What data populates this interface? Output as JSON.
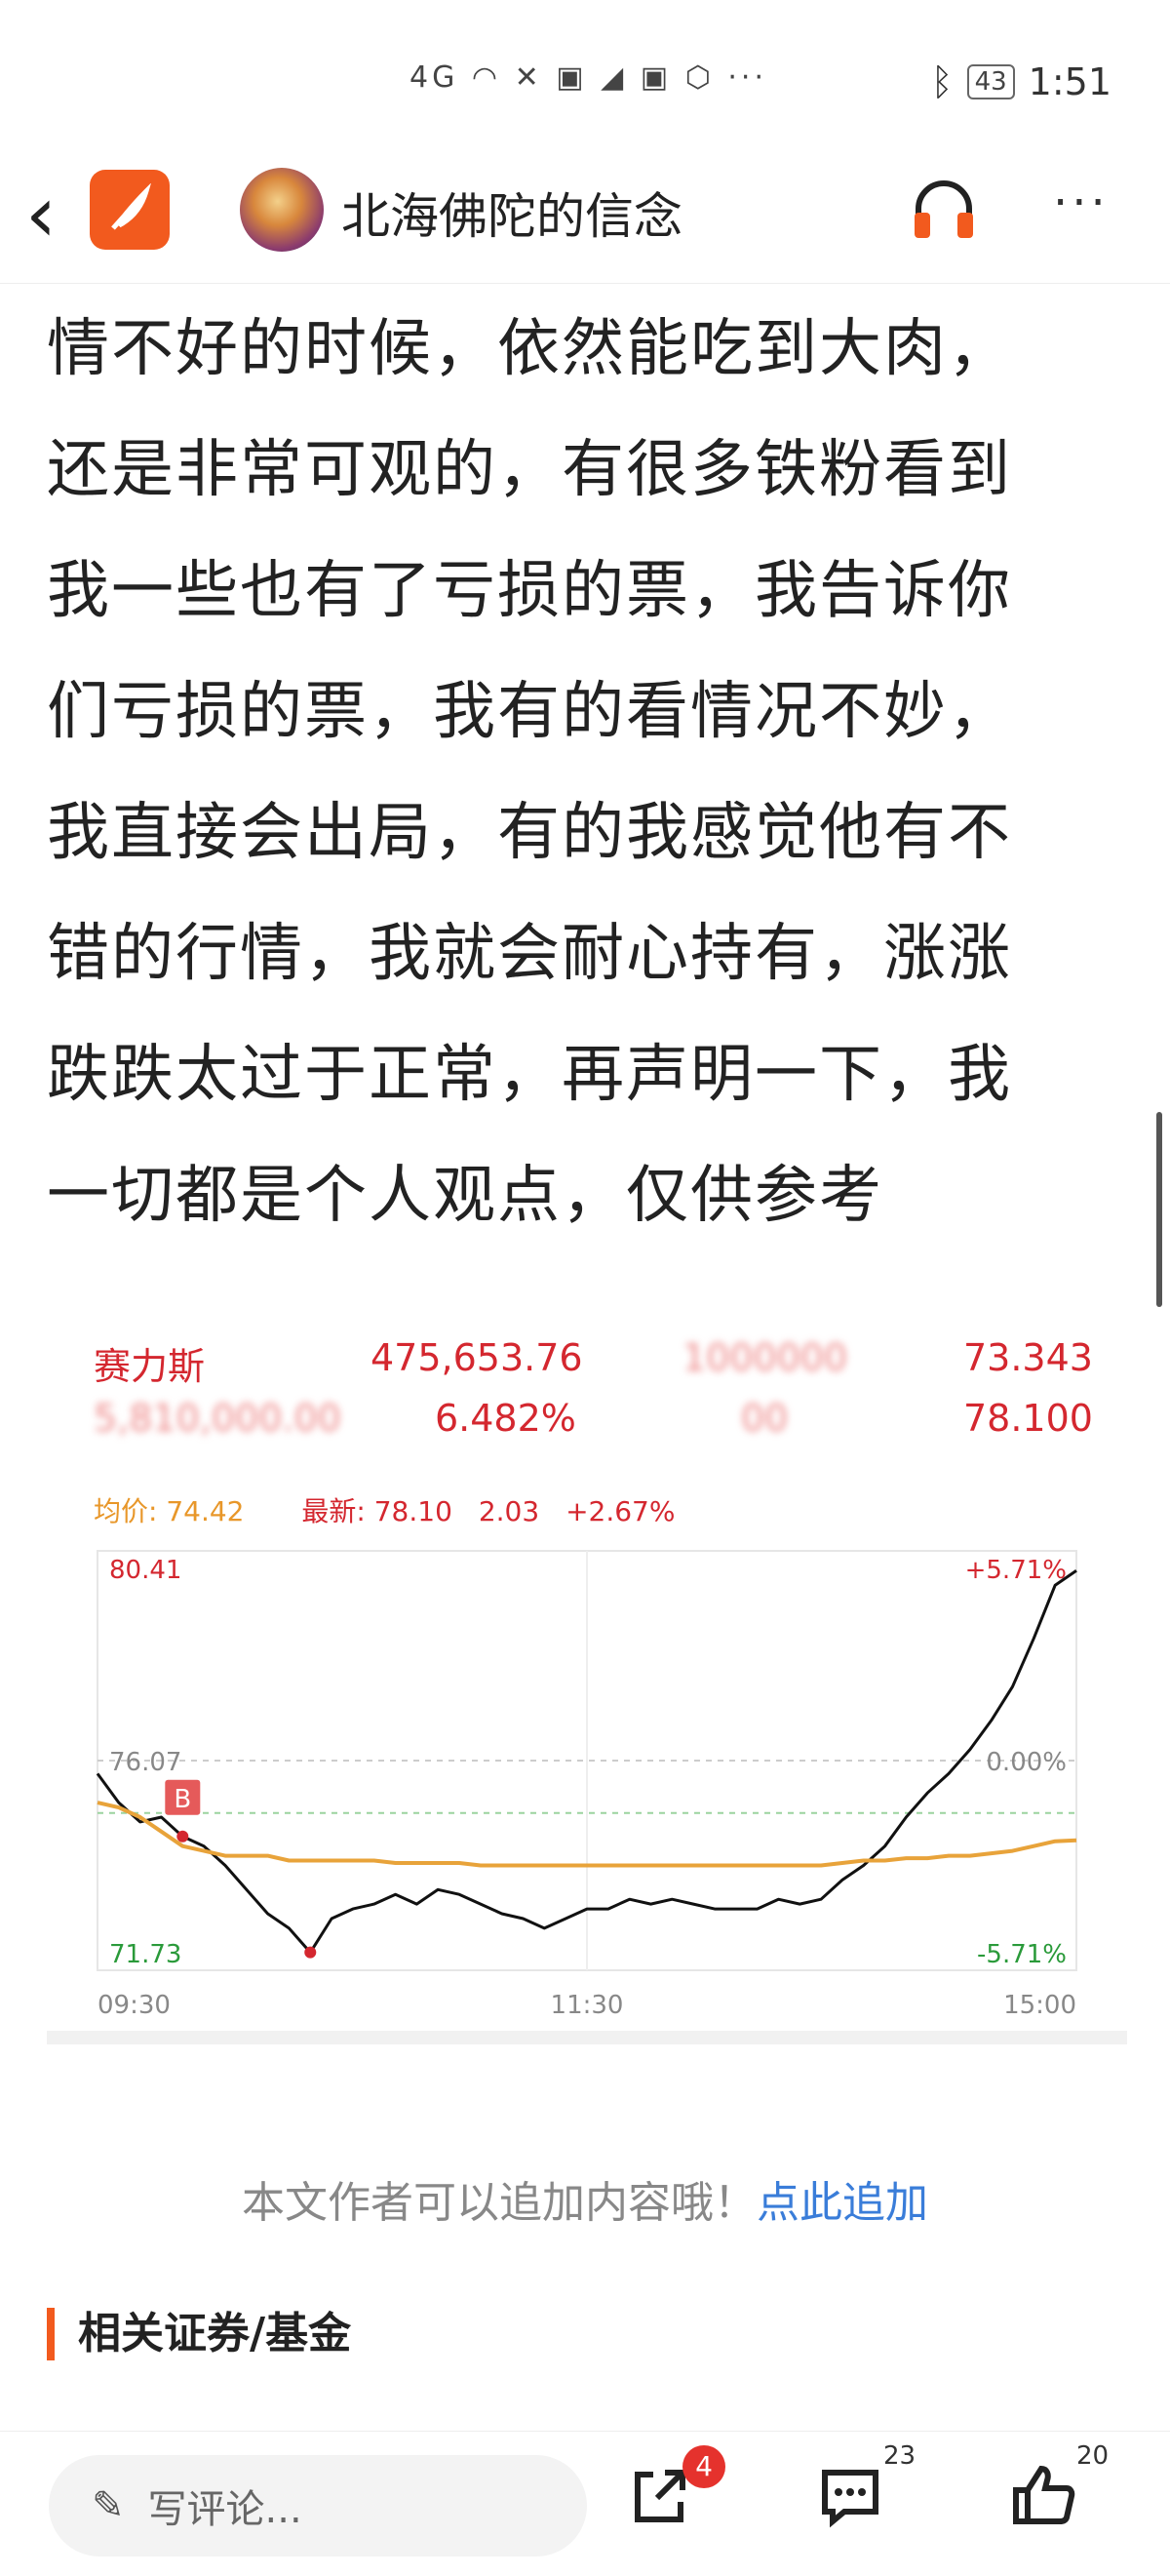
{
  "status": {
    "signal": "4G",
    "battery": "43",
    "time": "1:51"
  },
  "nav": {
    "author": "北海佛陀的信念"
  },
  "article": {
    "lines": [
      "情不好的时候，依然能吃到大肉，",
      "还是非常可观的，有很多铁粉看到",
      "我一些也有了亏损的票，我告诉你",
      "们亏损的票，我有的看情况不妙，",
      "我直接会出局，有的我感觉他有不",
      "错的行情，我就会耐心持有，涨涨",
      "跌跌太过于正常，再声明一下，我",
      "一切都是个人观点，仅供参考"
    ]
  },
  "quote": {
    "name": "赛力斯",
    "amount": "475,653.76",
    "price_top_right": "73.343",
    "volume": "5,810,000.00",
    "pct": "6.482%",
    "price_bottom_right": "78.100",
    "avg_label": "均价: 74.42",
    "latest_label": "最新: 78.10",
    "change": "2.03",
    "change_pct": "+2.67%"
  },
  "chart_data": {
    "type": "line",
    "title": "",
    "y_left_ticks": [
      "80.41",
      "76.07",
      "71.73"
    ],
    "y_right_ticks": [
      "+5.71%",
      "0.00%",
      "-5.71%"
    ],
    "x_ticks": [
      "09:30",
      "11:30",
      "15:00"
    ],
    "ylim": [
      71.73,
      80.41
    ],
    "buy_marker": "B",
    "series": [
      {
        "type": "price",
        "values": [
          75.8,
          75.2,
          74.8,
          74.9,
          74.5,
          74.3,
          73.9,
          73.4,
          72.9,
          72.6,
          72.1,
          72.8,
          73.0,
          73.1,
          73.3,
          73.1,
          73.4,
          73.3,
          73.1,
          72.9,
          72.8,
          72.6,
          72.8,
          73.0,
          73.0,
          73.2,
          73.1,
          73.2,
          73.1,
          73.0,
          73.0,
          73.0,
          73.2,
          73.1,
          73.2,
          73.6,
          73.9,
          74.3,
          74.9,
          75.4,
          75.8,
          76.3,
          76.9,
          77.6,
          78.6,
          79.7,
          80.0
        ]
      },
      {
        "type": "average",
        "values": [
          75.2,
          75.1,
          74.9,
          74.6,
          74.3,
          74.2,
          74.1,
          74.1,
          74.1,
          74.0,
          74.0,
          74.0,
          74.0,
          74.0,
          73.95,
          73.95,
          73.95,
          73.95,
          73.9,
          73.9,
          73.9,
          73.9,
          73.9,
          73.9,
          73.9,
          73.9,
          73.9,
          73.9,
          73.9,
          73.9,
          73.9,
          73.9,
          73.9,
          73.9,
          73.9,
          73.95,
          74.0,
          74.0,
          74.05,
          74.05,
          74.1,
          74.1,
          74.15,
          74.2,
          74.3,
          74.4,
          74.42
        ]
      }
    ]
  },
  "footer": {
    "add_text": "本文作者可以追加内容哦！",
    "add_link": "点此追加",
    "related": "相关证券/基金"
  },
  "bottom": {
    "comment_placeholder": "写评论...",
    "share_badge": "4",
    "comment_count": "23",
    "like_count": "20"
  },
  "colors": {
    "brand": "#f25a1e",
    "up": "#d4272f",
    "down": "#2a9a3a",
    "avg_line": "#e8a33a",
    "link": "#3a7dd9"
  }
}
